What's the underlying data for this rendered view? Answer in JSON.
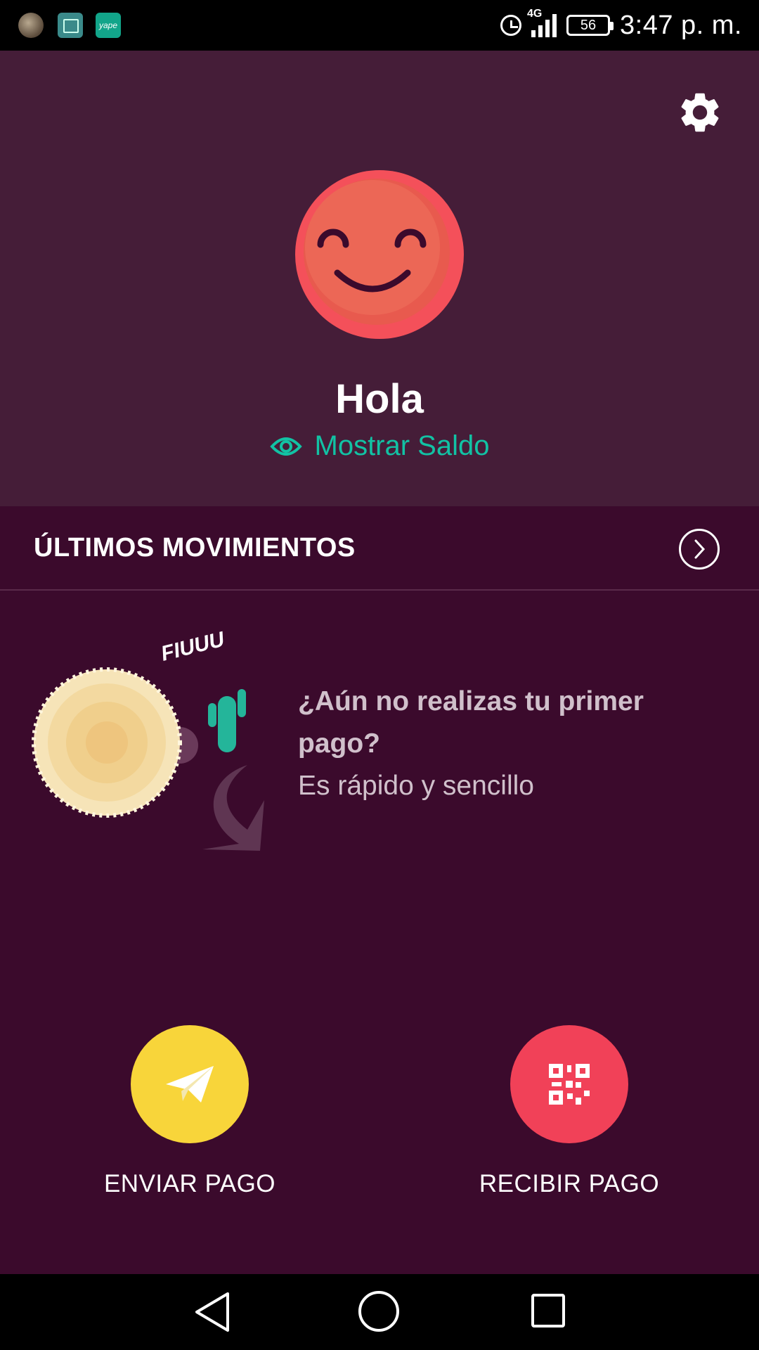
{
  "status_bar": {
    "time": "3:47 p. m.",
    "battery": "56",
    "network": "4G",
    "notification_icons": [
      "avatar-notification-icon",
      "gallery-icon",
      "yape-icon"
    ],
    "yape_text": "yape"
  },
  "header": {
    "settings_icon": "gear-icon",
    "greeting": "Hola",
    "show_balance": "Mostrar Saldo"
  },
  "movements": {
    "title": "ÚLTIMOS MOVIMIENTOS",
    "empty_question": "¿Aún no realizas tu primer pago?",
    "empty_subtitle": "Es rápido y sencillo",
    "illustration_text": "FIUUU"
  },
  "actions": {
    "send_label": "ENVIAR PAGO",
    "receive_label": "RECIBIR PAGO"
  },
  "colors": {
    "header_bg": "#451d38",
    "body_bg": "#3b0a2c",
    "accent_teal": "#12c2a4",
    "send_yellow": "#f8d53a",
    "receive_red": "#f14158",
    "avatar_red": "#f4505a"
  }
}
